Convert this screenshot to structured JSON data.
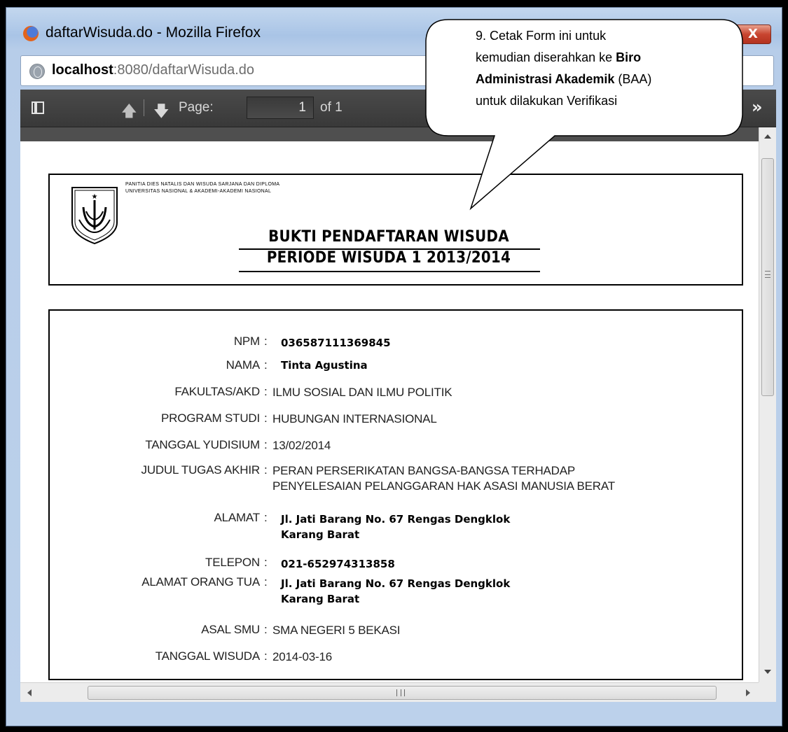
{
  "window": {
    "title": "daftarWisuda.do - Mozilla Firefox",
    "close_label": "X"
  },
  "address_bar": {
    "host": "localhost",
    "rest": ":8080/daftarWisuda.do"
  },
  "pdf_toolbar": {
    "page_label": "Page:",
    "page_value": "1",
    "page_of": "of 1"
  },
  "document": {
    "org_line_1": "PANITIA DIES NATALIS DAN WISUDA SARJANA DAN DIPLOMA",
    "org_line_2": "UNIVERSITAS NASIONAL & AKADEMI-AKADEMI NASIONAL",
    "title_line_1": "BUKTI PENDAFTARAN WISUDA",
    "title_line_2": "PERIODE WISUDA 1 2013/2014",
    "fields": [
      {
        "label": "NPM",
        "value": "036587111369845"
      },
      {
        "label": "NAMA",
        "value": "Tinta Agustina"
      },
      {
        "label": "FAKULTAS/AKD",
        "value": "ILMU SOSIAL DAN ILMU POLITIK"
      },
      {
        "label": "PROGRAM STUDI",
        "value": "HUBUNGAN INTERNASIONAL"
      },
      {
        "label": "TANGGAL YUDISIUM",
        "value": "13/02/2014"
      },
      {
        "label": "JUDUL TUGAS AKHIR",
        "value_line_1": "PERAN PERSERIKATAN BANGSA-BANGSA TERHADAP",
        "value_line_2": "PENYELESAIAN PELANGGARAN HAK ASASI MANUSIA BERAT"
      },
      {
        "label": "ALAMAT",
        "value_line_1": "Jl. Jati Barang No. 67 Rengas Dengklok",
        "value_line_2": "Karang Barat"
      },
      {
        "label": "TELEPON",
        "value": "021-652974313858"
      },
      {
        "label": "ALAMAT ORANG TUA",
        "value_line_1": "Jl. Jati Barang No. 67 Rengas Dengklok",
        "value_line_2": "Karang Barat"
      },
      {
        "label": "ASAL SMU",
        "value": "SMA NEGERI 5 BEKASI"
      },
      {
        "label": "TANGGAL WISUDA",
        "value": "2014-03-16"
      }
    ],
    "colon": ":"
  },
  "callout": {
    "line_1": "9. Cetak Form ini untuk",
    "line_2_plain": "kemudian diserahkan ke ",
    "line_2_bold": "Biro",
    "line_3_bold": "Administrasi Akademik",
    "line_3_plain": " (BAA)",
    "line_4": "untuk dilakukan Verifikasi"
  },
  "colors": {
    "toolbar_bg": "#393939",
    "window_frame": "#a9c4e6",
    "close_button": "#c84530"
  }
}
